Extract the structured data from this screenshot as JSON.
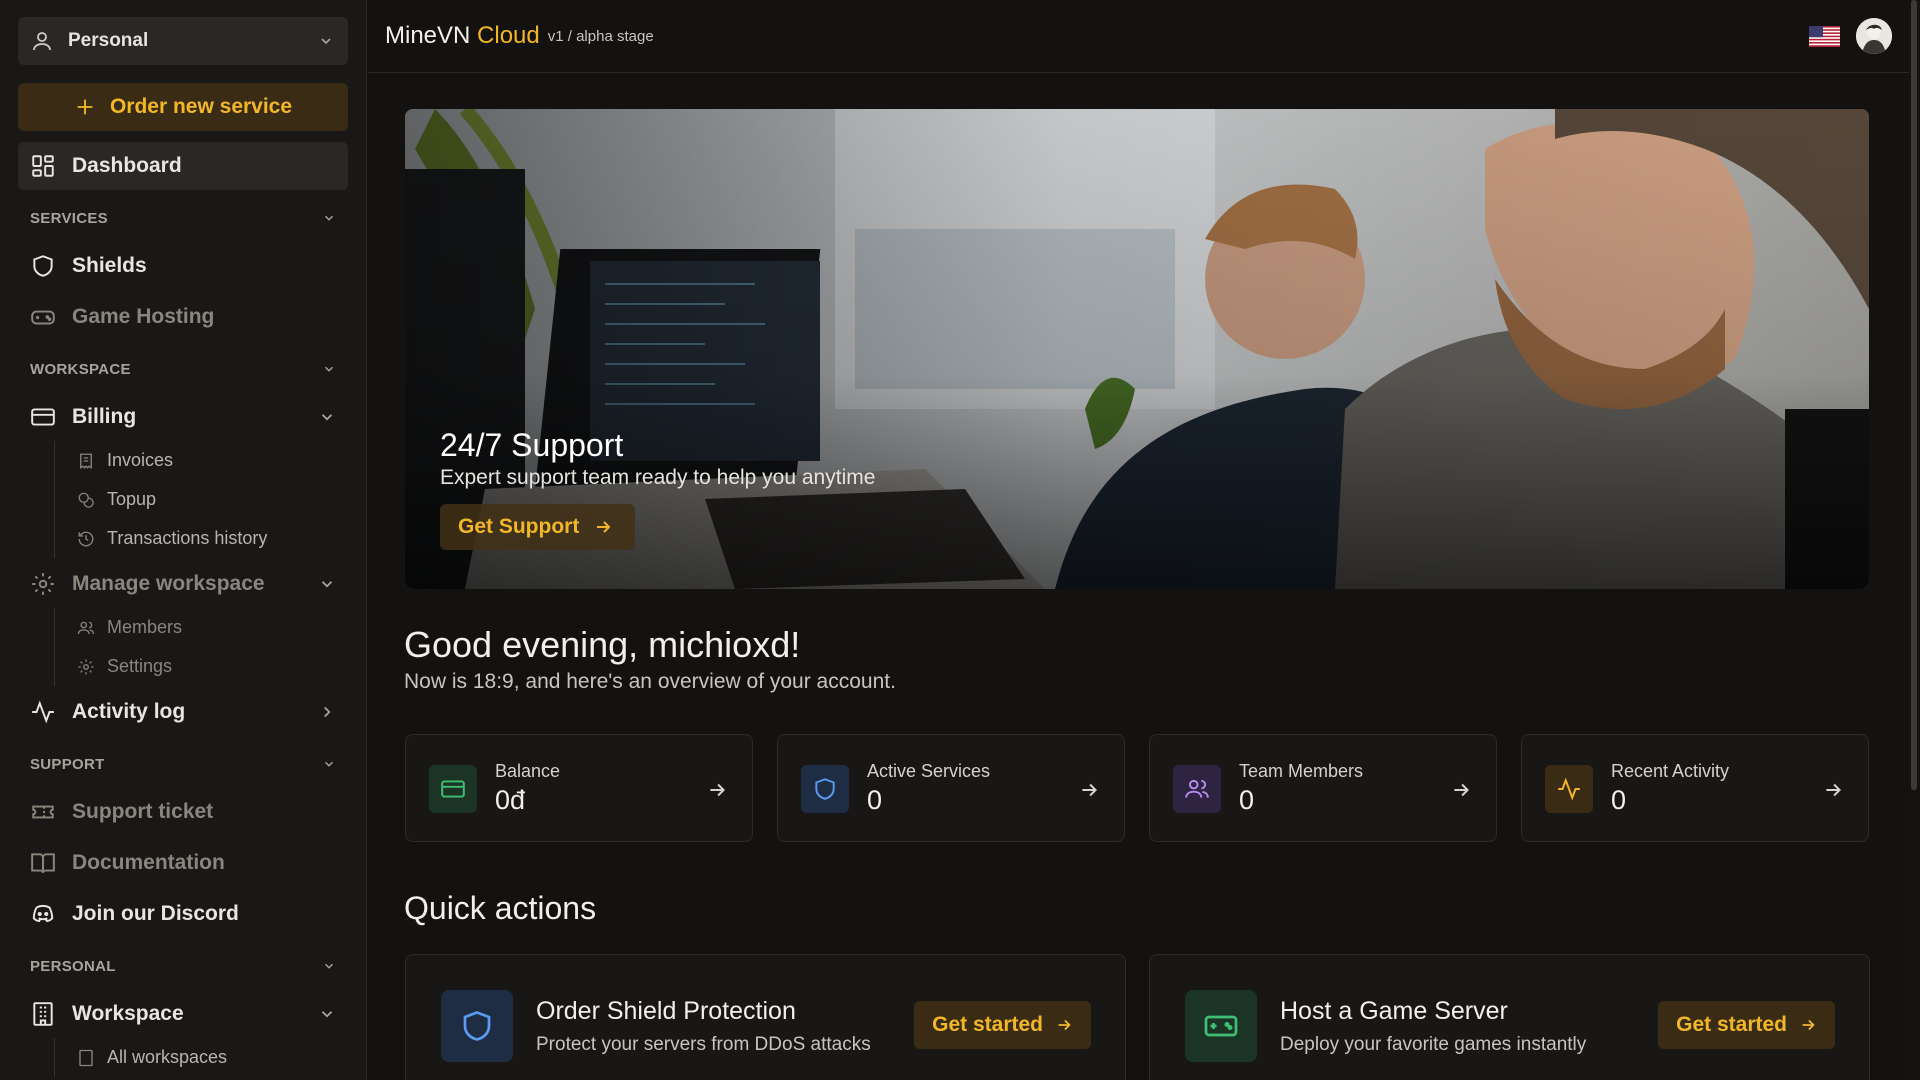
{
  "sidebar": {
    "workspace_select": "Personal",
    "order_button": "Order new service",
    "dashboard": "Dashboard",
    "sections": {
      "services": "SERVICES",
      "workspace": "WORKSPACE",
      "support": "SUPPORT",
      "personal": "PERSONAL"
    },
    "items": {
      "shields": "Shields",
      "game_hosting": "Game Hosting",
      "billing": "Billing",
      "invoices": "Invoices",
      "topup": "Topup",
      "transactions": "Transactions history",
      "manage_workspace": "Manage workspace",
      "members": "Members",
      "settings": "Settings",
      "activity_log": "Activity log",
      "support_ticket": "Support ticket",
      "documentation": "Documentation",
      "discord": "Join our Discord",
      "workspace": "Workspace",
      "all_workspaces": "All workspaces"
    }
  },
  "header": {
    "brand_main": "MineVN",
    "brand_accent": "Cloud",
    "version": "v1 / alpha stage"
  },
  "hero": {
    "title": "24/7 Support",
    "subtitle": "Expert support team ready to help you anytime",
    "button": "Get Support"
  },
  "greeting": {
    "title": "Good evening, michioxd!",
    "subtitle": "Now is 18:9, and here's an overview of your account."
  },
  "stats": [
    {
      "label": "Balance",
      "value": "0đ",
      "icon": "credit-card-icon",
      "color": "#3fbf74"
    },
    {
      "label": "Active Services",
      "value": "0",
      "icon": "shield-icon",
      "color": "#5b9bf0"
    },
    {
      "label": "Team Members",
      "value": "0",
      "icon": "users-icon",
      "color": "#b48cf0"
    },
    {
      "label": "Recent Activity",
      "value": "0",
      "icon": "activity-icon",
      "color": "#f2b629"
    }
  ],
  "quick_actions": {
    "title": "Quick actions",
    "cards": [
      {
        "title": "Order Shield Protection",
        "desc": "Protect your servers from DDoS attacks",
        "button": "Get started",
        "icon": "shield-icon"
      },
      {
        "title": "Host a Game Server",
        "desc": "Deploy your favorite games instantly",
        "button": "Get started",
        "icon": "gamepad-icon"
      }
    ]
  },
  "colors": {
    "accent": "#f2b629",
    "background": "#141210",
    "sidebar": "#1a1816"
  }
}
